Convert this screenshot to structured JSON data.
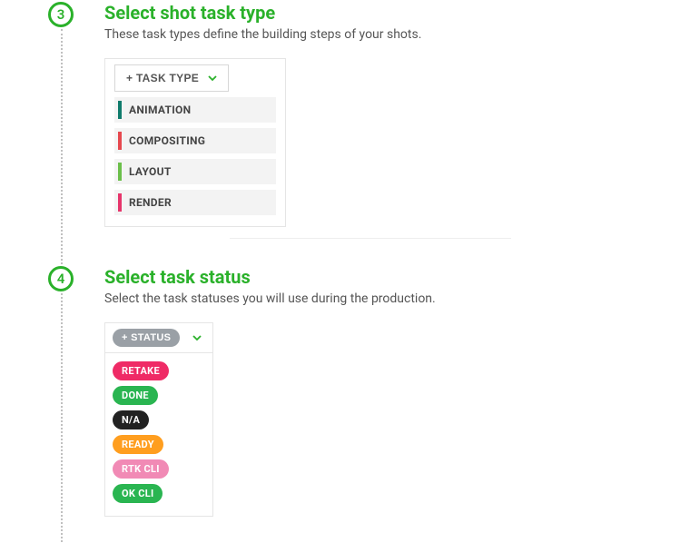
{
  "step3": {
    "number": "3",
    "title": "Select shot task type",
    "subtitle": "These task types define the building steps of your shots.",
    "dropdown_label": "+ TASK TYPE",
    "items": [
      {
        "label": "ANIMATION",
        "color": "#0f7b6c"
      },
      {
        "label": "COMPOSITING",
        "color": "#e6484e"
      },
      {
        "label": "LAYOUT",
        "color": "#6bbf4a"
      },
      {
        "label": "RENDER",
        "color": "#e6356b"
      }
    ]
  },
  "step4": {
    "number": "4",
    "title": "Select task status",
    "subtitle": "Select the task statuses you will use during the production.",
    "dropdown_label": "+ STATUS",
    "dropdown_color": "#9aa0a6",
    "items": [
      {
        "label": "RETAKE",
        "color": "#ef2b66"
      },
      {
        "label": "DONE",
        "color": "#2ab551"
      },
      {
        "label": "N/A",
        "color": "#222222"
      },
      {
        "label": "READY",
        "color": "#ff9e1f"
      },
      {
        "label": "RTK CLI",
        "color": "#f18ab5"
      },
      {
        "label": "OK CLI",
        "color": "#2ab551"
      }
    ]
  },
  "colors": {
    "accent": "#2ab12a"
  }
}
